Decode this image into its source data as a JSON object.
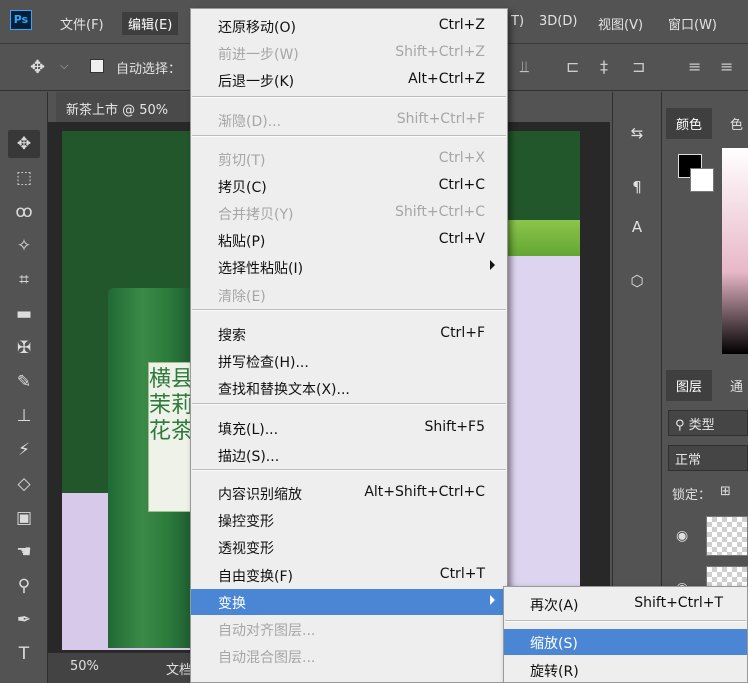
{
  "menubar": {
    "logo": "Ps",
    "items": [
      "文件(F)",
      "编辑(E)",
      "T)",
      "3D(D)",
      "视图(V)",
      "窗口(W)"
    ]
  },
  "options": {
    "auto_select": "自动选择："
  },
  "document": {
    "tab_title": "新茶上市 @ 50%",
    "zoom": "50%",
    "status_text": "文档",
    "tin_label": "横县茉莉花茶"
  },
  "panels": {
    "color_tab": "颜色",
    "color_tab2": "色",
    "layers_tab": "图层",
    "channels_tab": "通",
    "kind_filter": "类型",
    "blend_mode": "正常",
    "lock_label": "锁定："
  },
  "edit_menu": {
    "items": [
      {
        "label": "还原移动(O)",
        "shortcut": "Ctrl+Z",
        "disabled": false
      },
      {
        "label": "前进一步(W)",
        "shortcut": "Shift+Ctrl+Z",
        "disabled": true
      },
      {
        "label": "后退一步(K)",
        "shortcut": "Alt+Ctrl+Z",
        "disabled": false
      },
      {
        "label": "渐隐(D)...",
        "shortcut": "Shift+Ctrl+F",
        "disabled": true
      },
      {
        "label": "剪切(T)",
        "shortcut": "Ctrl+X",
        "disabled": true
      },
      {
        "label": "拷贝(C)",
        "shortcut": "Ctrl+C",
        "disabled": false
      },
      {
        "label": "合并拷贝(Y)",
        "shortcut": "Shift+Ctrl+C",
        "disabled": true
      },
      {
        "label": "粘贴(P)",
        "shortcut": "Ctrl+V",
        "disabled": false
      },
      {
        "label": "选择性粘贴(I)",
        "shortcut": "",
        "disabled": false
      },
      {
        "label": "清除(E)",
        "shortcut": "",
        "disabled": true
      },
      {
        "label": "搜索",
        "shortcut": "Ctrl+F",
        "disabled": false
      },
      {
        "label": "拼写检查(H)...",
        "shortcut": "",
        "disabled": false
      },
      {
        "label": "查找和替换文本(X)...",
        "shortcut": "",
        "disabled": false
      },
      {
        "label": "填充(L)...",
        "shortcut": "Shift+F5",
        "disabled": false
      },
      {
        "label": "描边(S)...",
        "shortcut": "",
        "disabled": false
      },
      {
        "label": "内容识别缩放",
        "shortcut": "Alt+Shift+Ctrl+C",
        "disabled": false
      },
      {
        "label": "操控变形",
        "shortcut": "",
        "disabled": false
      },
      {
        "label": "透视变形",
        "shortcut": "",
        "disabled": false
      },
      {
        "label": "自由变换(F)",
        "shortcut": "Ctrl+T",
        "disabled": false
      },
      {
        "label": "变换",
        "shortcut": "",
        "disabled": false
      },
      {
        "label": "自动对齐图层...",
        "shortcut": "",
        "disabled": true
      },
      {
        "label": "自动混合图层...",
        "shortcut": "",
        "disabled": true
      }
    ]
  },
  "transform_submenu": {
    "items": [
      {
        "label": "再次(A)",
        "shortcut": "Shift+Ctrl+T"
      },
      {
        "label": "缩放(S)",
        "shortcut": ""
      },
      {
        "label": "旋转(R)",
        "shortcut": ""
      }
    ]
  }
}
